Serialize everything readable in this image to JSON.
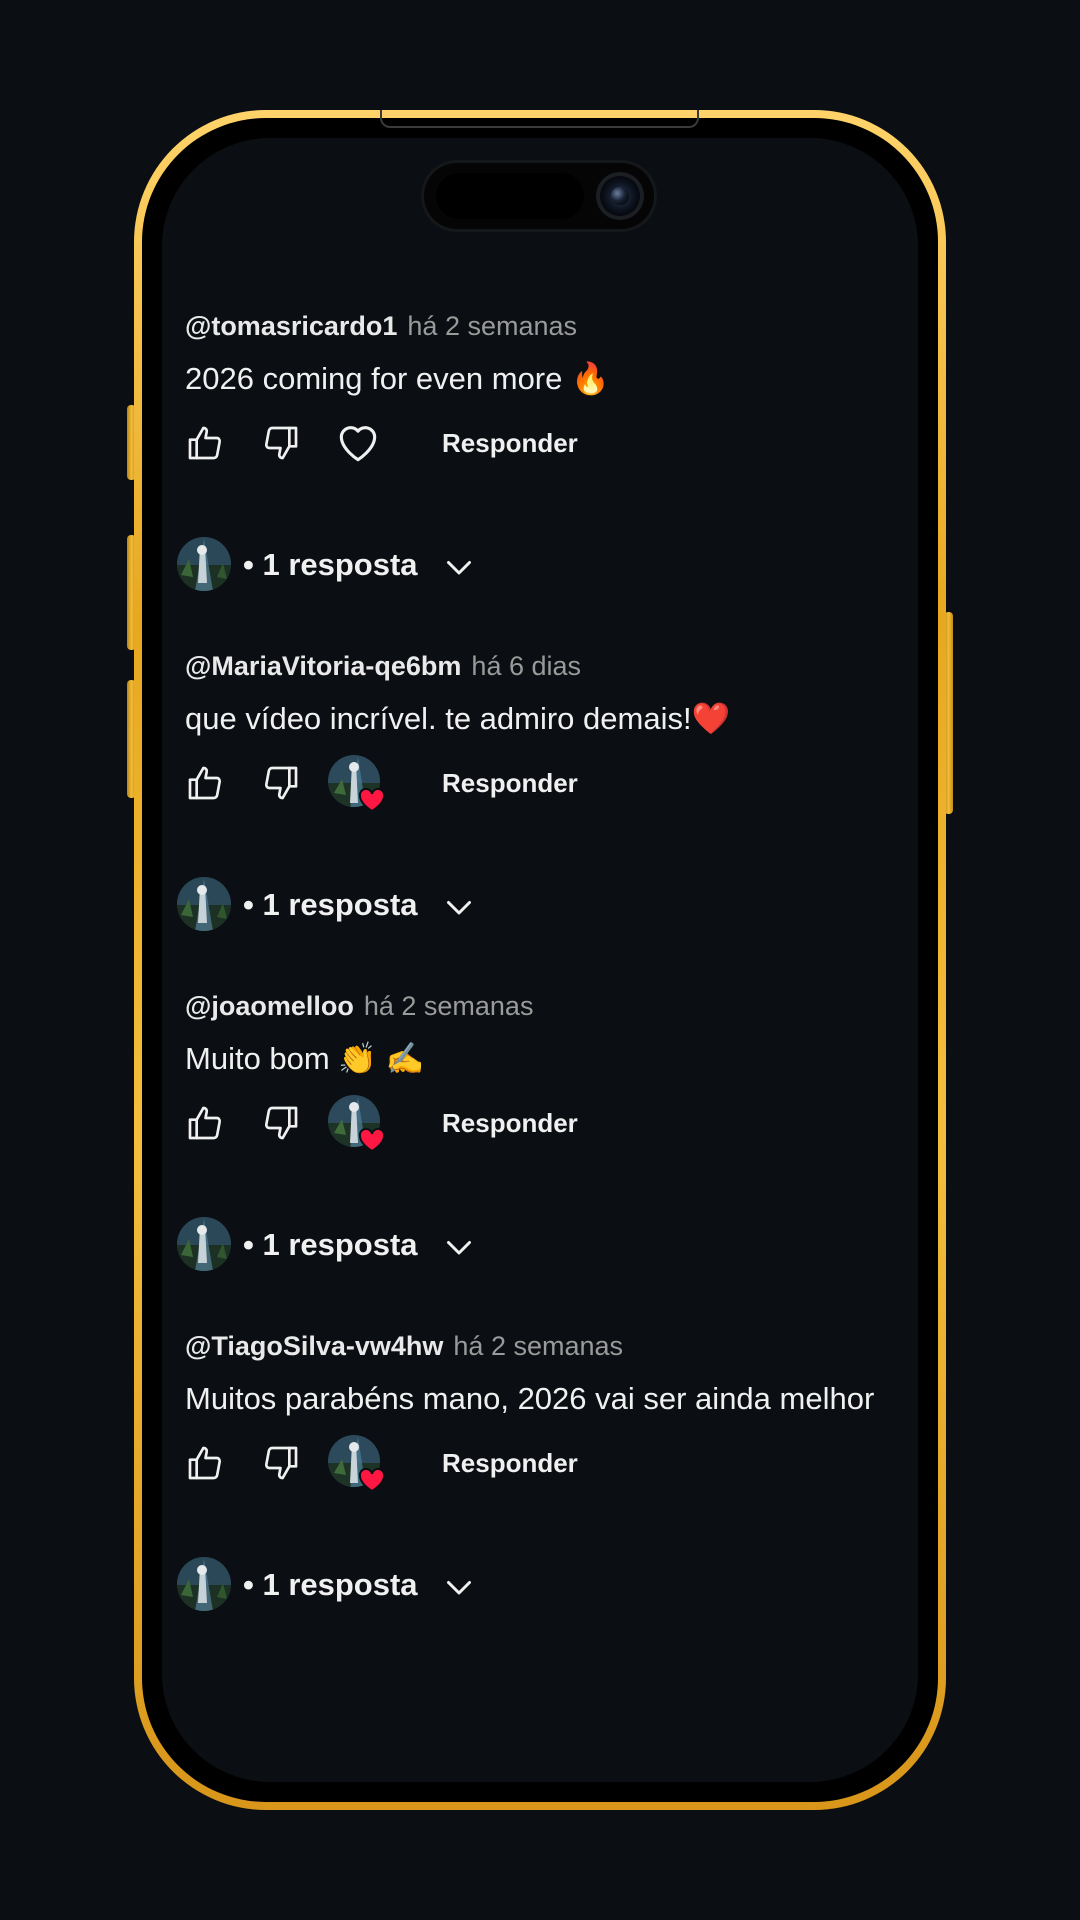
{
  "comments": [
    {
      "author": "@tomasricardo1",
      "time": "há 2 semanas",
      "text": "2026 coming for even more  🔥",
      "reply_label": "Responder",
      "creator_heart": false,
      "replies_label": "• 1 resposta"
    },
    {
      "author": "@MariaVitoria-qe6bm",
      "time": "há 6 dias",
      "text": "que vídeo incrível. te admiro demais!❤️",
      "reply_label": "Responder",
      "creator_heart": true,
      "replies_label": "• 1 resposta"
    },
    {
      "author": "@joaomelloo",
      "time": "há 2 semanas",
      "text": "Muito bom  👏 ✍️",
      "reply_label": "Responder",
      "creator_heart": true,
      "replies_label": "• 1 resposta"
    },
    {
      "author": "@TiagoSilva-vw4hw",
      "time": "há 2 semanas",
      "text": "Muitos parabéns mano, 2026 vai ser ainda melhor",
      "reply_label": "Responder",
      "creator_heart": true,
      "replies_label": "• 1 resposta"
    }
  ],
  "icons": {
    "like": "thumbs-up-icon",
    "dislike": "thumbs-down-icon",
    "heart": "heart-outline-icon",
    "creator_heart": "creator-heart-avatar",
    "expand": "chevron-down-icon"
  },
  "colors": {
    "background": "#0b0f13",
    "frame_gold": "#f4be3c",
    "heart_red": "#ff1744",
    "text_primary": "#f0f0f0",
    "text_secondary": "#9a9a9a"
  }
}
